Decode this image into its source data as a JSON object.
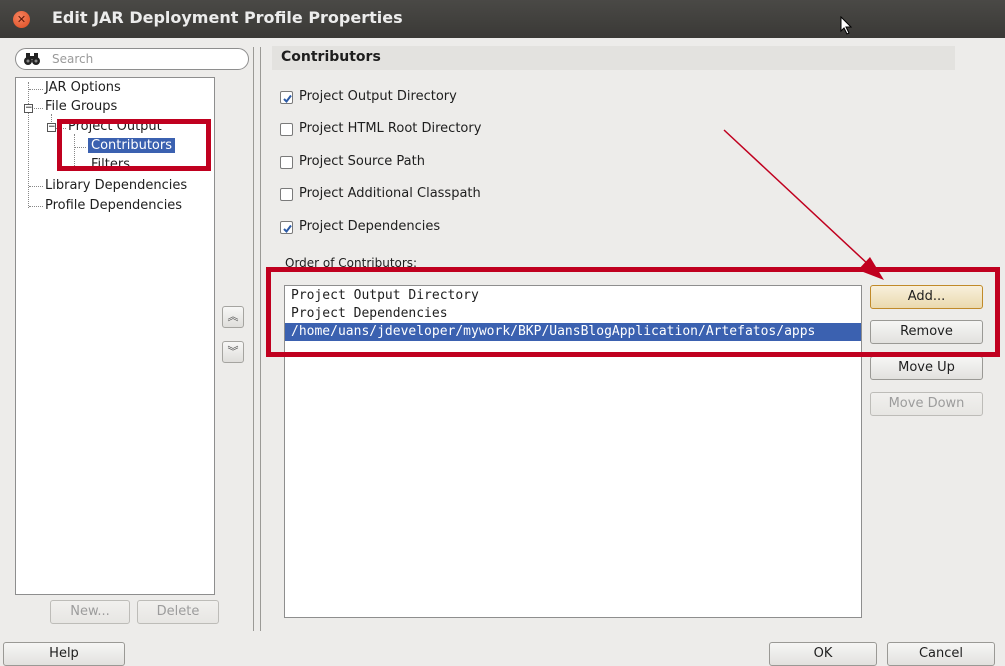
{
  "window": {
    "title": "Edit JAR Deployment Profile Properties"
  },
  "search": {
    "placeholder": "Search"
  },
  "tree": {
    "items": [
      {
        "label": "JAR Options"
      },
      {
        "label": "File Groups"
      },
      {
        "label": "Project Output"
      },
      {
        "label": "Contributors"
      },
      {
        "label": "Filters"
      },
      {
        "label": "Library Dependencies"
      },
      {
        "label": "Profile Dependencies"
      }
    ],
    "selected": "Contributors"
  },
  "left_buttons": {
    "new": "New...",
    "delete": "Delete"
  },
  "panel": {
    "title": "Contributors",
    "checkboxes": [
      {
        "label": "Project Output Directory",
        "checked": true
      },
      {
        "label": "Project HTML Root Directory",
        "checked": false
      },
      {
        "label": "Project Source Path",
        "checked": false
      },
      {
        "label": "Project Additional Classpath",
        "checked": false
      },
      {
        "label": "Project Dependencies",
        "checked": true
      }
    ],
    "order_label": "Order of Contributors:",
    "contributors": [
      "Project Output Directory",
      "Project Dependencies",
      "/home/uans/jdeveloper/mywork/BKP/UansBlogApplication/Artefatos/apps"
    ],
    "selected_index": 2,
    "buttons": {
      "add": "Add...",
      "remove": "Remove",
      "move_up": "Move Up",
      "move_down": "Move Down"
    }
  },
  "footer": {
    "help": "Help",
    "ok": "OK",
    "cancel": "Cancel"
  },
  "colors": {
    "selection": "#3b61b0",
    "highlight": "#c0001f",
    "titlebar": "#3f3e3b"
  },
  "icons": [
    "close-icon",
    "binoculars-icon",
    "up-arrow-icon",
    "down-arrow-icon",
    "checkmark-icon",
    "mouse-cursor-icon"
  ]
}
